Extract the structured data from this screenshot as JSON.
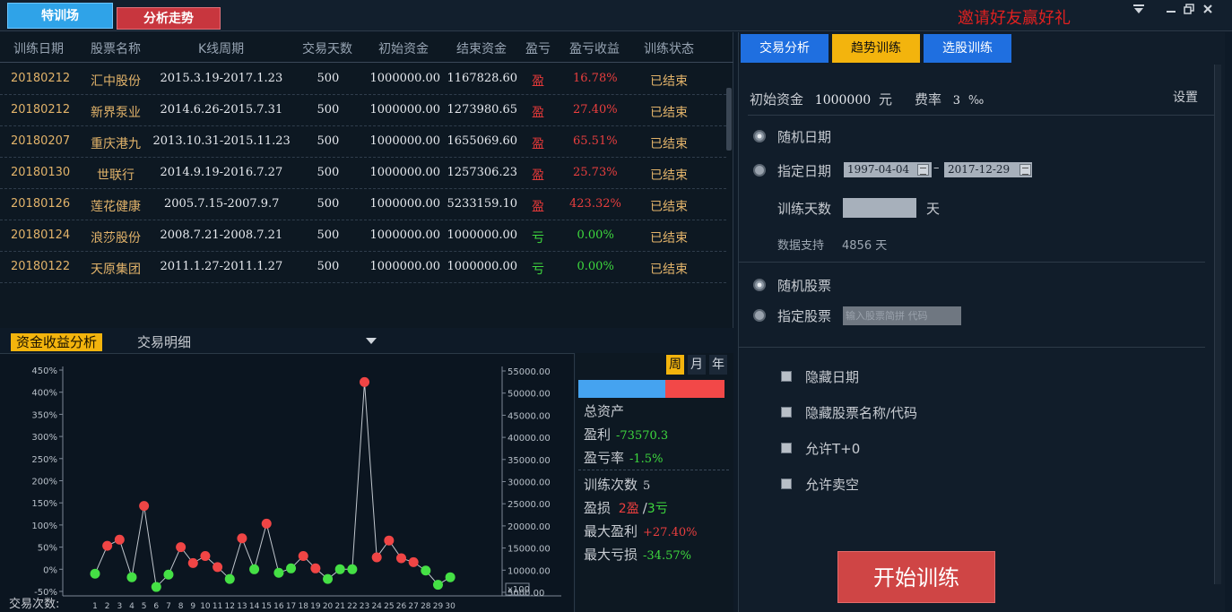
{
  "topbar": {
    "tab_train": "特训场",
    "tab_trend": "分析走势",
    "invite": "邀请好友赢好礼",
    "icons": [
      "dropdown-icon",
      "minimize-icon",
      "restore-icon",
      "close-icon"
    ]
  },
  "table": {
    "headers": [
      "训练日期",
      "股票名称",
      "K线周期",
      "交易天数",
      "初始资金",
      "结束资金",
      "盈亏",
      "盈亏收益",
      "训练状态"
    ],
    "rows": [
      {
        "date": "20180212",
        "name": "汇中股份",
        "period": "2015.3.19-2017.1.23",
        "days": "500",
        "init": "1000000.00",
        "end": "1167828.60",
        "pl": "盈",
        "ret": "16.78%",
        "status": "已结束"
      },
      {
        "date": "20180212",
        "name": "新界泵业",
        "period": "2014.6.26-2015.7.31",
        "days": "500",
        "init": "1000000.00",
        "end": "1273980.65",
        "pl": "盈",
        "ret": "27.40%",
        "status": "已结束"
      },
      {
        "date": "20180207",
        "name": "重庆港九",
        "period": "2013.10.31-2015.11.23",
        "days": "500",
        "init": "1000000.00",
        "end": "1655069.60",
        "pl": "盈",
        "ret": "65.51%",
        "status": "已结束"
      },
      {
        "date": "20180130",
        "name": "世联行",
        "period": "2014.9.19-2016.7.27",
        "days": "500",
        "init": "1000000.00",
        "end": "1257306.23",
        "pl": "盈",
        "ret": "25.73%",
        "status": "已结束"
      },
      {
        "date": "20180126",
        "name": "莲花健康",
        "period": "2005.7.15-2007.9.7",
        "days": "500",
        "init": "1000000.00",
        "end": "5233159.10",
        "pl": "盈",
        "ret": "423.32%",
        "status": "已结束"
      },
      {
        "date": "20180124",
        "name": "浪莎股份",
        "period": "2008.7.21-2008.7.21",
        "days": "500",
        "init": "1000000.00",
        "end": "1000000.00",
        "pl": "亏",
        "ret": "0.00%",
        "status": "已结束"
      },
      {
        "date": "20180122",
        "name": "天原集团",
        "period": "2011.1.27-2011.1.27",
        "days": "500",
        "init": "1000000.00",
        "end": "1000000.00",
        "pl": "亏",
        "ret": "0.00%",
        "status": "已结束"
      }
    ]
  },
  "analysis": {
    "tab_active": "资金收益分析",
    "tab_other": "交易明细"
  },
  "chart_data": {
    "type": "scatter",
    "xlabel": "交易次数:",
    "x": [
      1,
      2,
      3,
      4,
      5,
      6,
      7,
      8,
      9,
      10,
      11,
      12,
      13,
      14,
      15,
      16,
      17,
      18,
      19,
      20,
      21,
      22,
      23,
      24,
      25,
      26,
      27,
      28,
      29,
      30
    ],
    "y_left_ticks": [
      "450%",
      "400%",
      "350%",
      "300%",
      "250%",
      "200%",
      "150%",
      "100%",
      "50%",
      "0%",
      "-50%"
    ],
    "y_right_ticks": [
      "55000.00",
      "50000.00",
      "45000.00",
      "40000.00",
      "35000.00",
      "30000.00",
      "25000.00",
      "20000.00",
      "15000.00",
      "10000.00",
      "5000.00"
    ],
    "y_right_unit": "x100",
    "ylim": [
      -50,
      450
    ],
    "values": [
      -10,
      53,
      67,
      -18,
      143,
      -40,
      -12,
      50,
      14,
      30,
      5,
      -22,
      70,
      0,
      103,
      -8,
      2,
      30,
      2,
      -22,
      0,
      0,
      423,
      27,
      65,
      25,
      16,
      -3,
      -35,
      -18
    ],
    "win": [
      false,
      true,
      true,
      false,
      true,
      false,
      false,
      true,
      true,
      true,
      true,
      false,
      true,
      false,
      true,
      false,
      false,
      true,
      true,
      false,
      false,
      false,
      true,
      true,
      true,
      true,
      true,
      false,
      false,
      false
    ],
    "colors": {
      "win": "#f04545",
      "loss": "#45e045",
      "line": "#c0c6cd"
    }
  },
  "stats": {
    "period": [
      "周",
      "月",
      "年"
    ],
    "total_assets": "总资产",
    "profit_label": "盈利",
    "profit_value": "-73570.3",
    "ratio_label": "盈亏率",
    "ratio_value": "-1.5%",
    "count_label": "训练次数",
    "count_value": "5",
    "pl_label": "盈损",
    "pl_win": "2盈",
    "pl_sep": "/",
    "pl_lose": "3亏",
    "max_profit_label": "最大盈利",
    "max_profit_value": "+27.40%",
    "max_loss_label": "最大亏损",
    "max_loss_value": "-34.57%"
  },
  "right": {
    "tabs": [
      "交易分析",
      "趋势训练",
      "选股训练"
    ],
    "init_label": "初始资金",
    "init_value": "1000000",
    "init_unit": "元",
    "fee_label": "费率",
    "fee_value": "3",
    "fee_unit": "‰",
    "settings": "设置",
    "random_date": "随机日期",
    "specific_date": "指定日期",
    "date_from": "1997-04-04",
    "date_sep": "–",
    "date_to": "2017-12-29",
    "train_days_label": "训练天数",
    "train_days_unit": "天",
    "data_support_label": "数据支持",
    "data_support_value": "4856 天",
    "random_stock": "随机股票",
    "specific_stock": "指定股票",
    "stock_placeholder": "输入股票简拼 代码",
    "opt_hide_date": "隐藏日期",
    "opt_hide_name": "隐藏股票名称/代码",
    "opt_t0": "允许T+0",
    "opt_short": "允许卖空",
    "start": "开始训练"
  }
}
